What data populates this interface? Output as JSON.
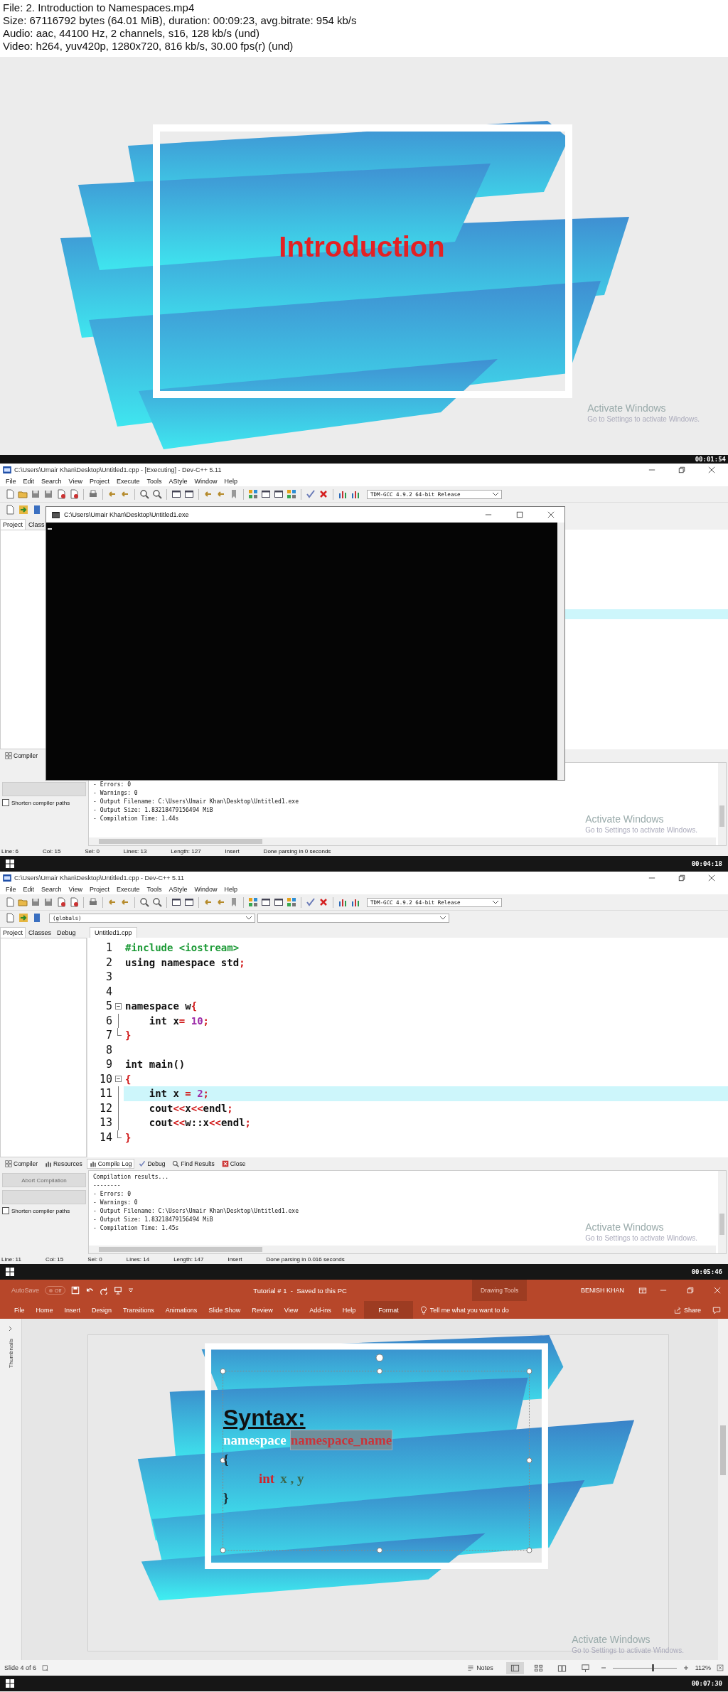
{
  "video_info": [
    "File: 2. Introduction to Namespaces.mp4",
    "Size: 67116792 bytes (64.01 MiB), duration: 00:09:23, avg.bitrate: 954 kb/s",
    "Audio: aac, 44100 Hz, 2 channels, s16, 128 kb/s (und)",
    "Video: h264, yuv420p, 1280x720, 816 kb/s, 30.00 fps(r) (und)"
  ],
  "frames": [
    {
      "kind": "slide",
      "title": "Introduction",
      "watermark": {
        "title": "Activate Windows",
        "hint": "Go to Settings to activate Windows."
      },
      "timestamp": "00:01:54"
    },
    {
      "kind": "devcpp",
      "window_title": "C:\\Users\\Umair Khan\\Desktop\\Untitled1.cpp - [Executing] - Dev-C++ 5.11",
      "menu": [
        "File",
        "Edit",
        "Search",
        "View",
        "Project",
        "Execute",
        "Tools",
        "AStyle",
        "Window",
        "Help"
      ],
      "compiler": "TDM-GCC 4.9.2 64-bit Release",
      "side_tabs": [
        {
          "label": "Project",
          "selected": true
        },
        {
          "label": "Class",
          "selected": false
        }
      ],
      "console": {
        "title": "C:\\Users\\Umair Khan\\Desktop\\Untitled1.exe"
      },
      "bottom_tabs": [
        {
          "label": "Compiler",
          "selected": false
        }
      ],
      "shorten_paths": {
        "label": "Shorten compiler paths",
        "checked": false
      },
      "log": [
        "- Errors: 0",
        "- Warnings: 0",
        "- Output Filename: C:\\Users\\Umair Khan\\Desktop\\Untitled1.exe",
        "- Output Size: 1.83218479156494 MiB",
        "- Compilation Time: 1.44s"
      ],
      "watermark": {
        "title": "Activate Windows",
        "hint": "Go to Settings to activate Windows."
      },
      "status": [
        {
          "label": "Line:",
          "value": "6"
        },
        {
          "label": "Col:",
          "value": "15"
        },
        {
          "label": "Sel:",
          "value": "0"
        },
        {
          "label": "Lines:",
          "value": "13"
        },
        {
          "label": "Length:",
          "value": "127"
        }
      ],
      "mode": "Insert",
      "message": "Done parsing in 0 seconds",
      "timestamp": "00:04:18"
    },
    {
      "kind": "devcpp",
      "window_title": "C:\\Users\\Umair Khan\\Desktop\\Untitled1.cpp - Dev-C++ 5.11",
      "menu": [
        "File",
        "Edit",
        "Search",
        "View",
        "Project",
        "Execute",
        "Tools",
        "AStyle",
        "Window",
        "Help"
      ],
      "compiler": "TDM-GCC 4.9.2 64-bit Release",
      "scope_select": "(globals)",
      "side_tabs": [
        {
          "label": "Project",
          "selected": true
        },
        {
          "label": "Classes",
          "selected": false
        },
        {
          "label": "Debug",
          "selected": false
        }
      ],
      "editor_tabs": [
        {
          "label": "Untitled1.cpp",
          "selected": true
        }
      ],
      "code": [
        {
          "no": "1",
          "current": false,
          "kind": "plain",
          "tokens": [
            {
              "t": "#include <iostream>",
              "kind": "pp"
            }
          ]
        },
        {
          "no": "2",
          "current": false,
          "kind": "plain",
          "tokens": [
            {
              "t": "using namespace std",
              "kind": "kw"
            },
            {
              "t": ";",
              "kind": "sym"
            }
          ]
        },
        {
          "no": "3",
          "current": false,
          "kind": "plain"
        },
        {
          "no": "4",
          "current": false,
          "kind": "plain"
        },
        {
          "no": "5",
          "current": false,
          "kind": "start",
          "tokens": [
            {
              "t": "namespace w",
              "kind": "kw"
            },
            {
              "t": "{",
              "kind": "sym"
            }
          ]
        },
        {
          "no": "6",
          "current": false,
          "kind": "line",
          "tokens": [
            {
              "t": "    int x",
              "kind": "kw"
            },
            {
              "t": "=",
              "kind": "sym"
            },
            {
              "t": " 10",
              "kind": "num"
            },
            {
              "t": ";",
              "kind": "sym"
            }
          ]
        },
        {
          "no": "7",
          "current": false,
          "kind": "end",
          "tokens": [
            {
              "t": "}",
              "kind": "sym"
            }
          ]
        },
        {
          "no": "8",
          "current": false,
          "kind": "plain"
        },
        {
          "no": "9",
          "current": false,
          "kind": "plain",
          "tokens": [
            {
              "t": "int main()",
              "kind": "kw"
            }
          ]
        },
        {
          "no": "10",
          "current": false,
          "kind": "start",
          "tokens": [
            {
              "t": "{",
              "kind": "sym"
            }
          ]
        },
        {
          "no": "11",
          "current": true,
          "kind": "line",
          "tokens": [
            {
              "t": "    int x ",
              "kind": "kw"
            },
            {
              "t": "=",
              "kind": "sym"
            },
            {
              "t": " 2",
              "kind": "num"
            },
            {
              "t": ";",
              "kind": "sym"
            }
          ]
        },
        {
          "no": "12",
          "current": false,
          "kind": "line",
          "tokens": [
            {
              "t": "    cout",
              "kind": "kw"
            },
            {
              "t": "<<",
              "kind": "sym"
            },
            {
              "t": "x",
              "kind": "kw"
            },
            {
              "t": "<<",
              "kind": "sym"
            },
            {
              "t": "endl",
              "kind": "kw"
            },
            {
              "t": ";",
              "kind": "sym"
            }
          ]
        },
        {
          "no": "13",
          "current": false,
          "kind": "line",
          "tokens": [
            {
              "t": "    cout",
              "kind": "kw"
            },
            {
              "t": "<<",
              "kind": "sym"
            },
            {
              "t": "w::x",
              "kind": "kw"
            },
            {
              "t": "<<",
              "kind": "sym"
            },
            {
              "t": "endl",
              "kind": "kw"
            },
            {
              "t": ";",
              "kind": "sym"
            }
          ]
        },
        {
          "no": "14",
          "current": false,
          "kind": "end",
          "tokens": [
            {
              "t": "}",
              "kind": "sym"
            }
          ]
        }
      ],
      "bottom_tabs": [
        {
          "label": "Compiler",
          "selected": false
        },
        {
          "label": "Resources",
          "selected": false
        },
        {
          "label": "Compile Log",
          "selected": true
        },
        {
          "label": "Debug",
          "selected": false
        },
        {
          "label": "Find Results",
          "selected": false
        },
        {
          "label": "Close",
          "selected": false
        }
      ],
      "abort_button": {
        "label": "Abort Compilation",
        "disabled": true
      },
      "shorten_paths": {
        "label": "Shorten compiler paths",
        "checked": false
      },
      "log": [
        "Compilation results...",
        "--------",
        "- Errors: 0",
        "- Warnings: 0",
        "- Output Filename: C:\\Users\\Umair Khan\\Desktop\\Untitled1.exe",
        "- Output Size: 1.83218479156494 MiB",
        "- Compilation Time: 1.45s"
      ],
      "watermark": {
        "title": "Activate Windows",
        "hint": "Go to Settings to activate Windows."
      },
      "status": [
        {
          "label": "Line:",
          "value": "11"
        },
        {
          "label": "Col:",
          "value": "15"
        },
        {
          "label": "Sel:",
          "value": "0"
        },
        {
          "label": "Lines:",
          "value": "14"
        },
        {
          "label": "Length:",
          "value": "147"
        }
      ],
      "mode": "Insert",
      "message": "Done parsing in 0.016 seconds",
      "timestamp": "00:05:46"
    },
    {
      "kind": "powerpoint",
      "autosave": {
        "label": "AutoSave",
        "toggle": "Off",
        "on": false
      },
      "doc_title": "Tutorial # 1  -  Saved to this PC",
      "context_group": "Drawing Tools",
      "user": "BENISH KHAN",
      "ribbon_tabs": [
        {
          "label": "File",
          "selected": false
        },
        {
          "label": "Home",
          "selected": false
        },
        {
          "label": "Insert",
          "selected": false
        },
        {
          "label": "Design",
          "selected": false
        },
        {
          "label": "Transitions",
          "selected": false
        },
        {
          "label": "Animations",
          "selected": false
        },
        {
          "label": "Slide Show",
          "selected": false
        },
        {
          "label": "Review",
          "selected": false
        },
        {
          "label": "View",
          "selected": false
        },
        {
          "label": "Add-ins",
          "selected": false
        },
        {
          "label": "Help",
          "selected": false
        },
        {
          "label": "Format",
          "selected": true
        }
      ],
      "tell_me": "Tell me what you want to do",
      "share": "Share",
      "thumbnails": "Thumbnails",
      "slide": {
        "heading": "Syntax:",
        "keyword": "namespace",
        "name": "namespace_name",
        "open": "{",
        "member_type": "int",
        "members": "x , y",
        "close": "}"
      },
      "watermark": {
        "title": "Activate Windows",
        "hint": "Go to Settings to activate Windows."
      },
      "status": {
        "slide": "Slide 4 of 6",
        "notes": "Notes",
        "zoom": "112%",
        "level": 0.62
      },
      "timestamp": "00:07:30"
    }
  ]
}
